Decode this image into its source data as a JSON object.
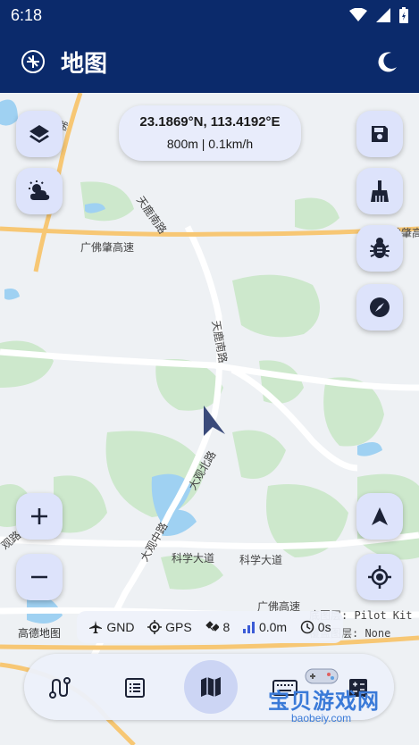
{
  "status_bar": {
    "time": "6:18"
  },
  "app_bar": {
    "title": "地图"
  },
  "coords": {
    "position": "23.1869°N, 113.4192°E",
    "info": "800m | 0.1km/h"
  },
  "map_labels": {
    "expressway_top": "广佛肇高速",
    "expressway_right": "广佛肇高速",
    "road_tianlu_1": "天鹿南路",
    "road_tianlu_2": "天鹿南路",
    "road_dagong_1": "大观北路",
    "road_dagong_2": "大观中路",
    "road_kexue_1": "科学大道",
    "road_kexue_2": "科学大道",
    "expressway_bottom": "广佛高速",
    "road_left_top": "广佛",
    "road_left_bottom": "观路",
    "attribution": "高德地图",
    "layer_info_1": "底图层: Pilot Kit",
    "layer_info_2": "覆盖图层: None"
  },
  "flight_status": {
    "mode": "GND",
    "gps": "GPS",
    "satellites": "8",
    "altitude": "0.0m",
    "timer": "0s"
  },
  "bottom_nav": {
    "active": "map"
  },
  "watermark": {
    "name": "宝贝游戏网",
    "url": "baobeiy.com"
  },
  "colors": {
    "app_bar": "#0b2a6b",
    "fab": "#dde3fb",
    "nav_active": "#ccd5f4",
    "drone_arrow": "#3a4a7a"
  }
}
